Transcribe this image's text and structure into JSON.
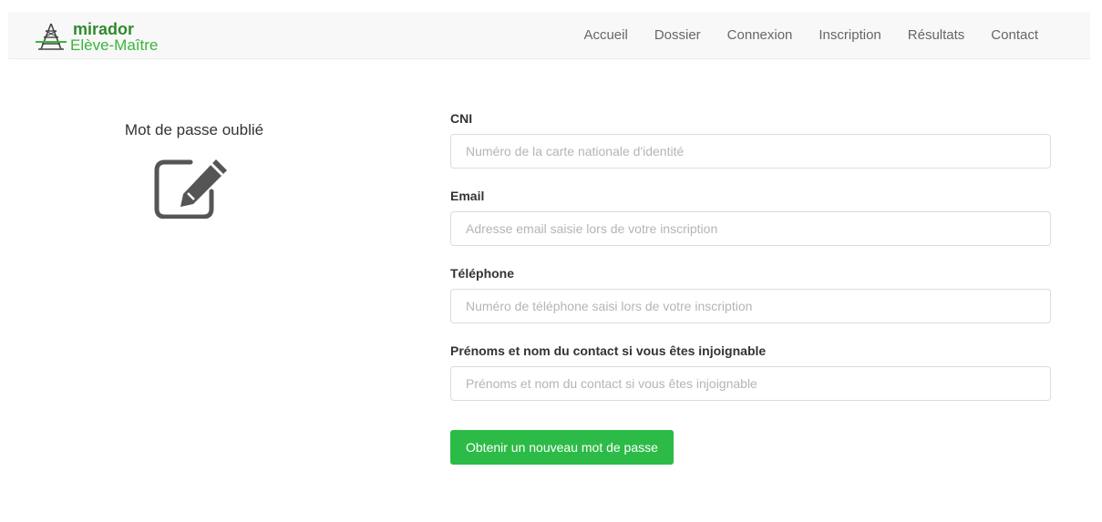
{
  "brand": {
    "name": "mirador",
    "subtitle": "Elève-Maître",
    "icon": "tower-icon",
    "colors": {
      "primary": "#2e8b2e",
      "secondary": "#3cb43c"
    }
  },
  "nav": {
    "items": [
      {
        "label": "Accueil"
      },
      {
        "label": "Dossier"
      },
      {
        "label": "Connexion"
      },
      {
        "label": "Inscription"
      },
      {
        "label": "Résultats"
      },
      {
        "label": "Contact"
      }
    ]
  },
  "side": {
    "title": "Mot de passe oublié",
    "icon": "edit-icon"
  },
  "form": {
    "fields": [
      {
        "label": "CNI",
        "placeholder": "Numéro de la carte nationale d'identité",
        "value": ""
      },
      {
        "label": "Email",
        "placeholder": "Adresse email saisie lors de votre inscription",
        "value": ""
      },
      {
        "label": "Téléphone",
        "placeholder": "Numéro de téléphone saisi lors de votre inscription",
        "value": ""
      },
      {
        "label": "Prénoms et nom du contact si vous êtes injoignable",
        "placeholder": "Prénoms et nom du contact si vous êtes injoignable",
        "value": ""
      }
    ],
    "submit_label": "Obtenir un nouveau mot de passe",
    "submit_color": "#2dbb47"
  }
}
